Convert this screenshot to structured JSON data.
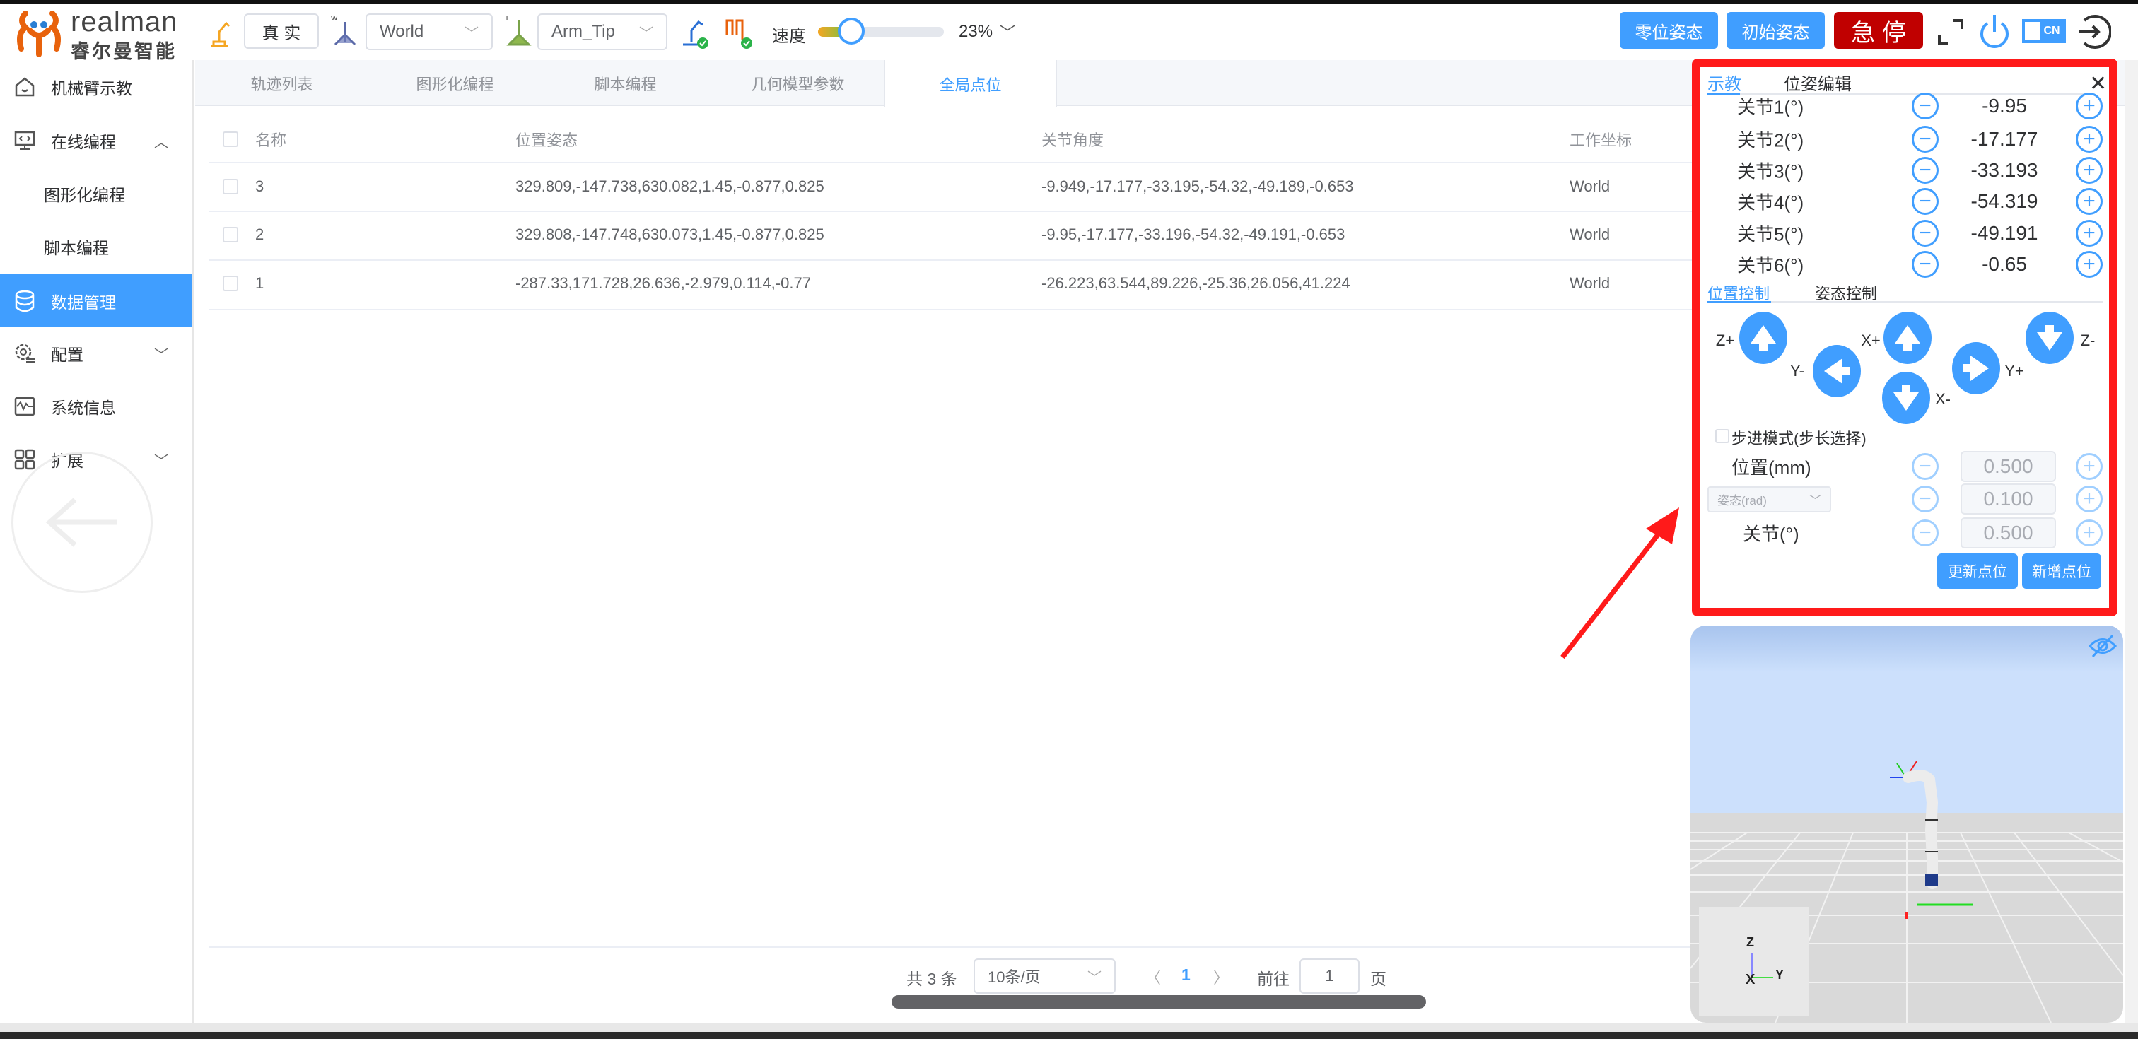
{
  "header": {
    "logo_text": "realman",
    "logo_subtext": "睿尔曼智能",
    "mode_button": "真 实",
    "frame_select": {
      "prefix": "W",
      "value": "World"
    },
    "tool_select": {
      "prefix": "T",
      "value": "Arm_Tip"
    },
    "speed_label": "速度",
    "speed_percent": 23,
    "speed_value": "23%",
    "zero_pose_button": "零位姿态",
    "init_pose_button": "初始姿态",
    "estop_button": "急 停",
    "lang_toggle": "CN"
  },
  "sidebar": {
    "items": [
      {
        "label": "机械臂示教",
        "icon": "home-icon"
      },
      {
        "label": "在线编程",
        "icon": "code-monitor-icon",
        "expanded": true
      },
      {
        "label": "图形化编程"
      },
      {
        "label": "脚本编程"
      },
      {
        "label": "数据管理",
        "icon": "database-icon",
        "active": true
      },
      {
        "label": "配置",
        "icon": "gear-icon"
      },
      {
        "label": "系统信息",
        "icon": "waveform-icon"
      },
      {
        "label": "扩展",
        "icon": "grid-icon"
      }
    ]
  },
  "tabs": [
    {
      "label": "轨迹列表"
    },
    {
      "label": "图形化编程"
    },
    {
      "label": "脚本编程"
    },
    {
      "label": "几何模型参数"
    },
    {
      "label": "全局点位",
      "active": true
    }
  ],
  "table": {
    "columns": [
      "名称",
      "位置姿态",
      "关节角度",
      "工作坐标"
    ],
    "rows": [
      {
        "name": "3",
        "pose": "329.809,-147.738,630.082,1.45,-0.877,0.825",
        "joints": "-9.949,-17.177,-33.195,-54.32,-49.189,-0.653",
        "frame": "World"
      },
      {
        "name": "2",
        "pose": "329.808,-147.748,630.073,1.45,-0.877,0.825",
        "joints": "-9.95,-17.177,-33.196,-54.32,-49.191,-0.653",
        "frame": "World"
      },
      {
        "name": "1",
        "pose": "-287.33,171.728,26.636,-2.979,0.114,-0.77",
        "joints": "-26.223,63.544,89.226,-25.36,26.056,41.224",
        "frame": "World"
      }
    ]
  },
  "pagination": {
    "total": "共 3 条",
    "page_size": "10条/页",
    "current_page": "1",
    "goto_label": "前往",
    "goto_value": "1",
    "page_suffix": "页"
  },
  "teach_panel": {
    "tabs": [
      "示教",
      "位姿编辑"
    ],
    "active_tab": "示教",
    "joints": [
      {
        "label": "关节1(°)",
        "value": "-9.95"
      },
      {
        "label": "关节2(°)",
        "value": "-17.177"
      },
      {
        "label": "关节3(°)",
        "value": "-33.193"
      },
      {
        "label": "关节4(°)",
        "value": "-54.319"
      },
      {
        "label": "关节5(°)",
        "value": "-49.191"
      },
      {
        "label": "关节6(°)",
        "value": "-0.65"
      }
    ],
    "control_tabs": [
      "位置控制",
      "姿态控制"
    ],
    "arrows": {
      "z_plus": "Z+",
      "y_minus": "Y-",
      "x_plus": "X+",
      "x_minus": "X-",
      "y_plus": "Y+",
      "z_minus": "Z-"
    },
    "step_mode_label": "步进模式(步长选择)",
    "step_mode_checked": false,
    "position_label": "位置(mm)",
    "position_step": "0.500",
    "orientation_select": "姿态(rad)",
    "orientation_step": "0.100",
    "joint_label": "关节(°)",
    "joint_step": "0.500",
    "update_button": "更新点位",
    "add_button": "新增点位"
  },
  "view3d": {
    "axis_labels": {
      "z": "Z",
      "y": "Y",
      "x": "X"
    }
  },
  "colors": {
    "primary": "#409eff",
    "estop": "#c00000",
    "annotation": "#ff1a1a",
    "logo": "#e8620c"
  }
}
